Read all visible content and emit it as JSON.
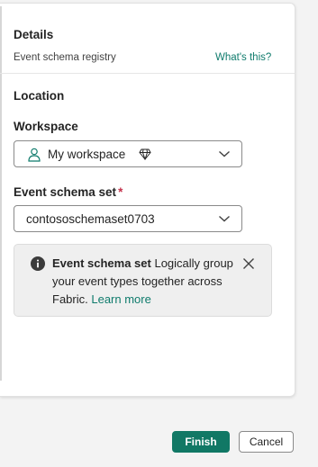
{
  "details": {
    "title": "Details",
    "item_type": "Event schema registry",
    "help_link": "What's this?"
  },
  "location": {
    "title": "Location",
    "workspace_label": "Workspace",
    "workspace_value": "My workspace",
    "schema_set_label": "Event schema set",
    "required_marker": "*",
    "schema_set_value": "contososchemaset0703"
  },
  "callout": {
    "title": "Event schema set",
    "body": "Logically group your event types together across Fabric.",
    "link": "Learn more"
  },
  "footer": {
    "finish_label": "Finish",
    "cancel_label": "Cancel"
  },
  "colors": {
    "accent": "#117865",
    "link": "#0f7b6c",
    "required": "#c4314b"
  },
  "icons": {
    "workspace": "person-icon",
    "premium": "diamond-icon",
    "info": "info-icon",
    "close": "close-icon"
  }
}
